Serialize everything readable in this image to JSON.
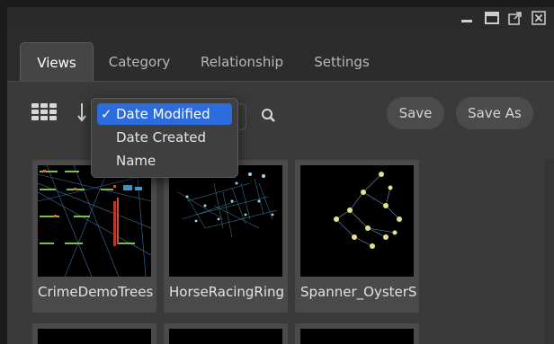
{
  "window": {
    "controls": [
      "minimize-icon",
      "maximize-icon",
      "popout-icon",
      "close-icon"
    ]
  },
  "tabs": [
    {
      "label": "Views",
      "active": true
    },
    {
      "label": "Category",
      "active": false
    },
    {
      "label": "Relationship",
      "active": false
    },
    {
      "label": "Settings",
      "active": false
    }
  ],
  "toolbar": {
    "save_label": "Save",
    "save_as_label": "Save As"
  },
  "sort_menu": {
    "options": [
      {
        "label": "Date Modified",
        "checkmark": "✓",
        "selected": true
      },
      {
        "label": "Date Created",
        "selected": false
      },
      {
        "label": "Name",
        "selected": false
      }
    ]
  },
  "views": [
    {
      "name": "CrimeDemoTrees"
    },
    {
      "name": "HorseRacingRing"
    },
    {
      "name": "Spanner_OysterS"
    }
  ],
  "colors": {
    "window_bg": "#2c2c2c",
    "content_bg": "#3a3a3a",
    "selected_blue": "#2d6cdf",
    "button_bg": "#4b4b4b"
  }
}
